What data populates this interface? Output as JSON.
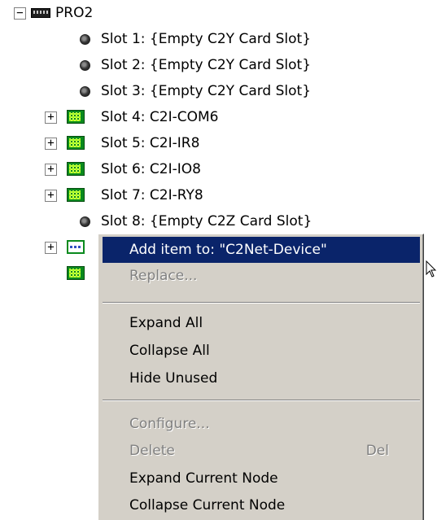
{
  "tree": {
    "root": {
      "label": "PRO2",
      "toggle": "−"
    },
    "items": [
      {
        "label": "Slot 1: {Empty C2Y Card Slot}",
        "type": "empty"
      },
      {
        "label": "Slot 2: {Empty C2Y Card Slot}",
        "type": "empty"
      },
      {
        "label": "Slot 3: {Empty C2Y Card Slot}",
        "type": "empty"
      },
      {
        "label": "Slot 4: C2I-COM6",
        "type": "card",
        "toggle": "+"
      },
      {
        "label": "Slot 5: C2I-IR8",
        "type": "card",
        "toggle": "+"
      },
      {
        "label": "Slot 6: C2I-IO8",
        "type": "card",
        "toggle": "+"
      },
      {
        "label": "Slot 7: C2I-RY8",
        "type": "card",
        "toggle": "+"
      },
      {
        "label": "Slot 8: {Empty C2Z Card Slot}",
        "type": "empty"
      }
    ],
    "net_device": {
      "toggle": "+",
      "icon": "network-device-icon"
    },
    "last_item": {
      "icon": "card-icon"
    }
  },
  "context_menu": {
    "add_item": "Add item to: \"C2Net-Device\"",
    "replace": "Replace...",
    "expand_all": "Expand All",
    "collapse_all": "Collapse All",
    "hide_unused": "Hide Unused",
    "configure": "Configure...",
    "delete": "Delete",
    "delete_shortcut": "Del",
    "expand_current": "Expand Current Node",
    "collapse_current": "Collapse Current Node"
  },
  "colors": {
    "selection": "#0a246a",
    "menu_bg": "#d4d0c8",
    "card_green": "#0a8a1e"
  }
}
